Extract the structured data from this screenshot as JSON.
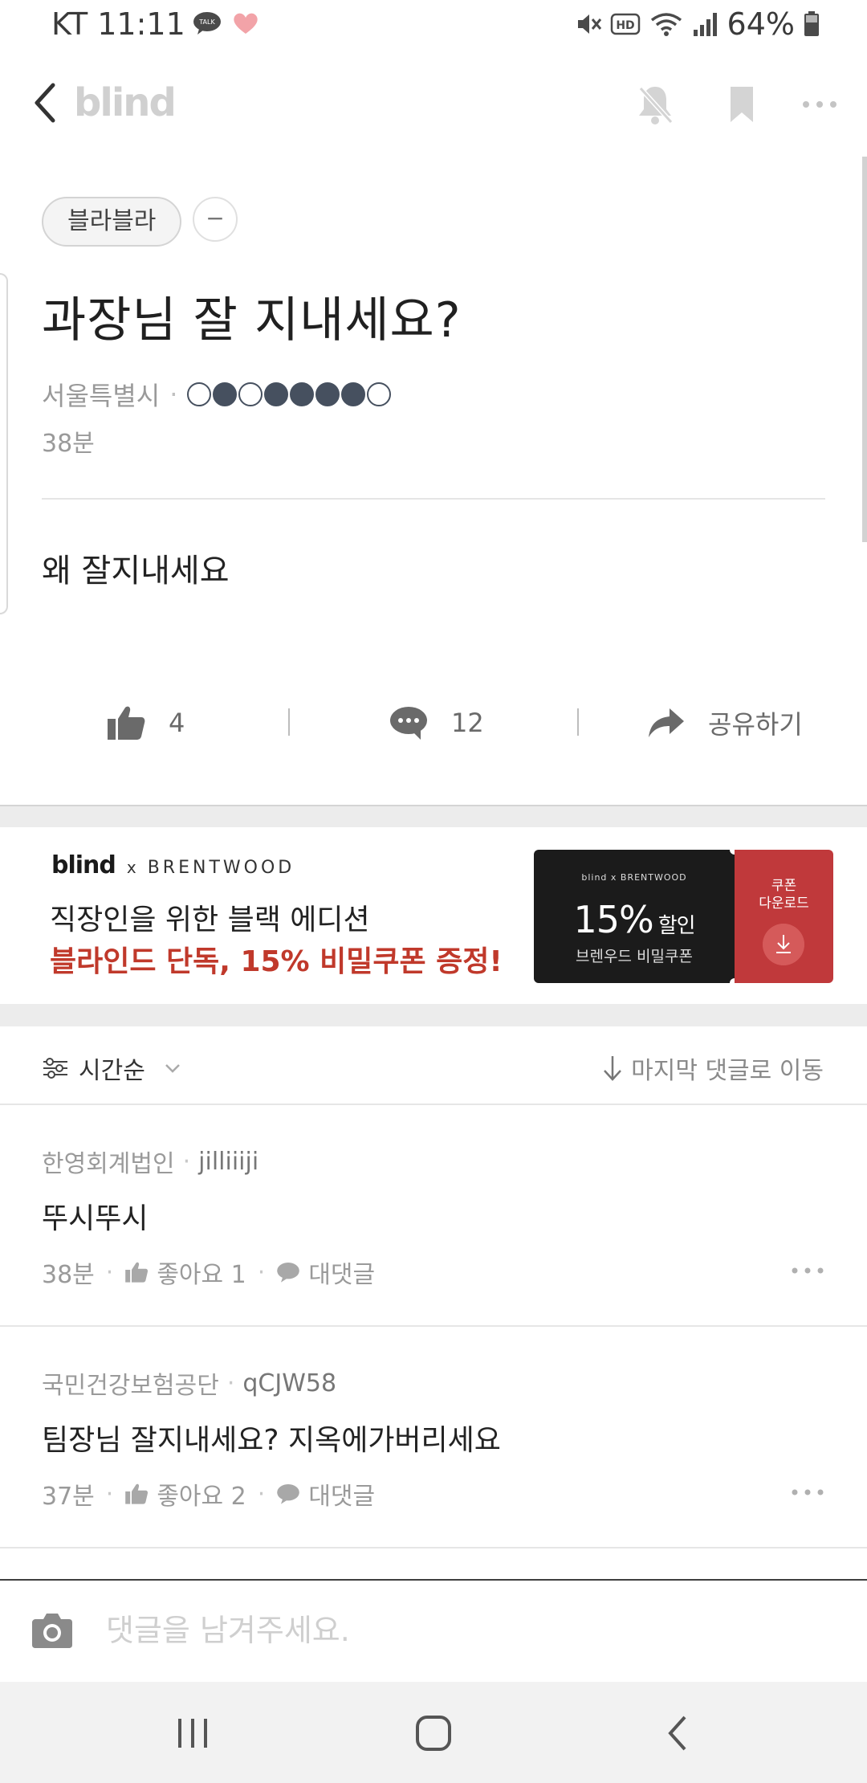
{
  "status_bar": {
    "carrier_time": "KT 11:11",
    "talk_badge": "TALK",
    "battery_percent": "64%",
    "icons": [
      "kakaotalk-icon",
      "heart-icon",
      "mute-icon",
      "hd-icon",
      "wifi-icon",
      "signal-icon",
      "battery-icon"
    ]
  },
  "header": {
    "logo": "blind",
    "icons": [
      "back-icon",
      "notification-off-icon",
      "bookmark-icon",
      "more-icon"
    ]
  },
  "post": {
    "category": "블라블라",
    "collapse_symbol": "−",
    "title": "과장님 잘 지내세요?",
    "location": "서울특별시",
    "rating_dots": [
      0,
      1,
      0,
      1,
      1,
      1,
      1,
      0
    ],
    "time_ago": "38분",
    "body": "왜 잘지내세요",
    "likes": "4",
    "comments": "12",
    "share_label": "공유하기"
  },
  "ad": {
    "brand_blind": "blind",
    "brand_x": "x",
    "brand_partner": "BRENTWOOD",
    "line1": "직장인을 위한 블랙 에디션",
    "line2": "블라인드 단독, 15% 비밀쿠폰 증정!",
    "coupon_brand": "blind x BRENTWOOD",
    "coupon_percent": "15%",
    "coupon_discount_word": "할인",
    "coupon_sub": "브렌우드 비밀쿠폰",
    "coupon_download_line1": "쿠폰",
    "coupon_download_line2": "다운로드",
    "colors": {
      "accent_red": "#c0393b",
      "dark": "#1b1b1b"
    }
  },
  "comments_header": {
    "sort_label": "시간순",
    "jump_label": "마지막 댓글로 이동"
  },
  "comments": [
    {
      "company": "한영회계법인",
      "nickname": "jilliiiji",
      "text": "뚜시뚜시",
      "time": "38분",
      "like_label": "좋아요 1",
      "reply_label": "대댓글"
    },
    {
      "company": "국민건강보험공단",
      "nickname": "qCJW58",
      "text": "팀장님 잘지내세요? 지옥에가버리세요",
      "time": "37분",
      "like_label": "좋아요 2",
      "reply_label": "대댓글"
    }
  ],
  "composer": {
    "placeholder": "댓글을 남겨주세요."
  },
  "nav": {
    "icons": [
      "recent-apps-icon",
      "home-icon",
      "back-nav-icon"
    ]
  }
}
